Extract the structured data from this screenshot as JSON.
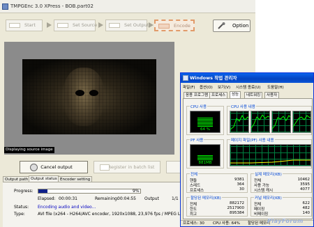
{
  "main_window": {
    "title": "TMPGEnc 3.0 XPress - BOB.part02",
    "steps": [
      {
        "label": "Start",
        "icon": "start-icon"
      },
      {
        "label": "Set Source",
        "icon": "source-icon"
      },
      {
        "label": "Set Output",
        "icon": "output-icon"
      },
      {
        "label": "Encode",
        "icon": "encode-icon"
      }
    ],
    "option_label": "Option",
    "option_icon": "wrench-icon",
    "preview_caption": "Displaying source image",
    "cancel_label": "Cancel output",
    "cancel_icon": "cancel-icon",
    "register_label": "Register in batch list",
    "tabs": [
      "Output path",
      "Output status",
      "Encoder setting"
    ],
    "active_tab": 1,
    "status": {
      "progress_label": "Progress:",
      "progress_percent": "9%",
      "progress_fraction": 0.09,
      "elapsed_label": "Elapsed:",
      "elapsed_value": "00:00:31",
      "remaining_label": "Remaining:",
      "remaining_value": "00:04:55",
      "output_label": "Output",
      "output_value": "1/1",
      "status_label": "Status:",
      "status_value": "Encoding audio and video...",
      "type_label": "Type:",
      "type_value": "AVI file (x264 - H264/AVC encoder, 1920x1088, 23,976 fps / MPEG Layer-3, 56"
    }
  },
  "task_manager": {
    "title": "Windows 작업 관리자",
    "menu": [
      "파일(F)",
      "옵션(O)",
      "보기(V)",
      "시스템 종료(U)",
      "도움말(H)"
    ],
    "tabs": [
      "응용 프로그램",
      "프로세스",
      "성능",
      "네트워킹",
      "사용자"
    ],
    "active_tab": 2,
    "cpu_usage_title": "CPU 사용",
    "cpu_usage_value": "64 %",
    "cpu_history_title": "CPU 사용 내용",
    "pf_usage_title": "PF 사용",
    "pf_usage_value": "881MB",
    "pf_history_title": "페이지 파일(PF) 사용 내용",
    "totals": {
      "title": "전체",
      "rows": [
        {
          "label": "핸들",
          "value": "9381"
        },
        {
          "label": "스레드",
          "value": "364"
        },
        {
          "label": "프로세스",
          "value": "30"
        }
      ]
    },
    "physical_memory": {
      "title": "실제 메모리(KB)",
      "rows": [
        {
          "label": "전체",
          "value": "10462"
        },
        {
          "label": "사용 가능",
          "value": "3595"
        },
        {
          "label": "시스템 캐시",
          "value": "4077"
        }
      ]
    },
    "commit_charge": {
      "title": "할당된 메모리(KB)",
      "rows": [
        {
          "label": "전체",
          "value": "882172"
        },
        {
          "label": "한도",
          "value": "2517900"
        },
        {
          "label": "최고",
          "value": "895384"
        }
      ]
    },
    "kernel_memory": {
      "title": "커널 메모리(KB)",
      "rows": [
        {
          "label": "전체",
          "value": "622"
        },
        {
          "label": "페이징",
          "value": "482"
        },
        {
          "label": "비페이징",
          "value": "140"
        }
      ]
    },
    "statusbar": {
      "processes": "프로세스: 30",
      "cpu": "CPU 사용: 64%",
      "commit": "할당된 메모리"
    }
  },
  "watermark": "PlayForum"
}
